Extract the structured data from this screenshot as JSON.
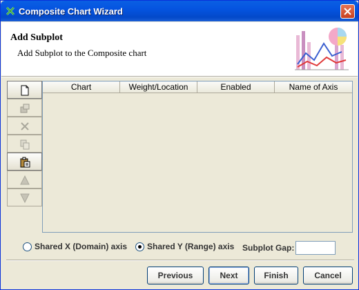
{
  "window": {
    "title": "Composite Chart Wizard",
    "app_icon": "wizard-icon",
    "close_icon": "close-icon"
  },
  "header": {
    "title": "Add Subplot",
    "subtitle": "Add Subplot to the Composite chart",
    "logo_icon": "chart-logo-icon"
  },
  "toolbar": {
    "buttons": [
      {
        "icon": "new-document-icon",
        "enabled": true
      },
      {
        "icon": "properties-icon",
        "enabled": false
      },
      {
        "icon": "delete-icon",
        "enabled": false
      },
      {
        "icon": "copy-icon",
        "enabled": false
      },
      {
        "icon": "paste-icon",
        "enabled": true
      },
      {
        "icon": "move-up-icon",
        "enabled": false
      },
      {
        "icon": "move-down-icon",
        "enabled": false
      }
    ]
  },
  "table": {
    "columns": [
      "Chart",
      "Weight/Location",
      "Enabled",
      "Name of Axis"
    ],
    "rows": []
  },
  "options": {
    "shared_x_label": "Shared X (Domain) axis",
    "shared_y_label": "Shared Y (Range) axis",
    "selected_axis": "shared_y",
    "subplot_gap_label": "Subplot Gap:",
    "subplot_gap_value": ""
  },
  "buttons": {
    "previous": "Previous",
    "next": "Next",
    "finish": "Finish",
    "cancel": "Cancel"
  },
  "colors": {
    "titlebar": "#0554e0",
    "dialog_bg": "#ece9d8",
    "header_bg": "#ffffff"
  }
}
